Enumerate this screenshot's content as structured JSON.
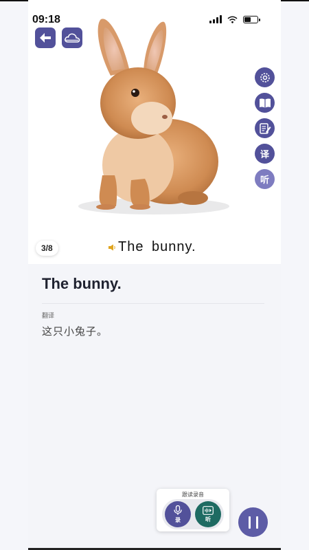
{
  "status_bar": {
    "time": "09:18",
    "battery_level": 0.45
  },
  "toolbar": {
    "back_icon": "arrow-left-icon",
    "cloud_icon": "cloud-icon"
  },
  "side_tools": {
    "settings_icon": "gear-icon",
    "book_icon": "open-book-icon",
    "notes_icon": "edit-note-icon",
    "translate_label": "译",
    "listen_label": "听"
  },
  "page": {
    "counter": "3/8",
    "caption": "The bunny."
  },
  "lesson": {
    "sentence": "The bunny.",
    "translation_label": "翻译",
    "translation": "这只小兔子。"
  },
  "recording": {
    "title": "跟读录音",
    "record_label": "录",
    "listen_label": "听"
  },
  "colors": {
    "accent": "#52519a",
    "listen_green": "#1e6b62",
    "background": "#f4f5f9"
  }
}
